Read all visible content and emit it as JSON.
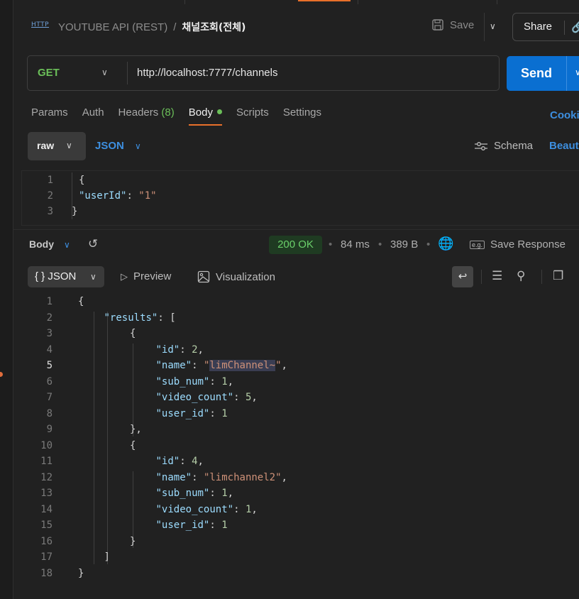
{
  "header": {
    "icon_text": "HTTP",
    "collection": "YOUTUBE API (REST)",
    "separator": "/",
    "request_name": "채널조회(전체)",
    "save_label": "Save",
    "share_label": "Share"
  },
  "request": {
    "method": "GET",
    "url": "http://localhost:7777/channels",
    "send_label": "Send"
  },
  "tabs": {
    "params": "Params",
    "auth": "Auth",
    "headers": "Headers",
    "headers_count": "(8)",
    "body": "Body",
    "scripts": "Scripts",
    "settings": "Settings",
    "cookies": "Cookies"
  },
  "body_options": {
    "mode": "raw",
    "format": "JSON",
    "schema_label": "Schema",
    "beautify_label": "Beautify"
  },
  "request_body": [
    {
      "n": "1",
      "text": "{"
    },
    {
      "n": "2",
      "key": "\"userId\"",
      "sep": ": ",
      "value": "\"1\""
    },
    {
      "n": "3",
      "text": "}"
    }
  ],
  "response": {
    "section_label": "Body",
    "status": "200 OK",
    "time": "84 ms",
    "size": "389 B",
    "save_response_label": "Save Response",
    "view_format": "{ } JSON",
    "preview_label": "Preview",
    "visualization_label": "Visualization"
  },
  "response_lines": [
    {
      "n": "1",
      "indent": 0,
      "parts": [
        [
          "punc",
          "{"
        ]
      ]
    },
    {
      "n": "2",
      "indent": 1,
      "parts": [
        [
          "key",
          "\"results\""
        ],
        [
          "punc",
          ": ["
        ]
      ]
    },
    {
      "n": "3",
      "indent": 2,
      "parts": [
        [
          "punc",
          "{"
        ]
      ]
    },
    {
      "n": "4",
      "indent": 3,
      "parts": [
        [
          "key",
          "\"id\""
        ],
        [
          "punc",
          ": "
        ],
        [
          "num",
          "2"
        ],
        [
          "punc",
          ","
        ]
      ]
    },
    {
      "n": "5",
      "indent": 3,
      "parts": [
        [
          "key",
          "\"name\""
        ],
        [
          "punc",
          ": "
        ],
        [
          "str",
          "\""
        ],
        [
          "str hl",
          "limChannel~"
        ],
        [
          "str",
          "\""
        ],
        [
          "punc",
          ","
        ]
      ]
    },
    {
      "n": "6",
      "indent": 3,
      "parts": [
        [
          "key",
          "\"sub_num\""
        ],
        [
          "punc",
          ": "
        ],
        [
          "num",
          "1"
        ],
        [
          "punc",
          ","
        ]
      ]
    },
    {
      "n": "7",
      "indent": 3,
      "parts": [
        [
          "key",
          "\"video_count\""
        ],
        [
          "punc",
          ": "
        ],
        [
          "num",
          "5"
        ],
        [
          "punc",
          ","
        ]
      ]
    },
    {
      "n": "8",
      "indent": 3,
      "parts": [
        [
          "key",
          "\"user_id\""
        ],
        [
          "punc",
          ": "
        ],
        [
          "num",
          "1"
        ]
      ]
    },
    {
      "n": "9",
      "indent": 2,
      "parts": [
        [
          "punc",
          "},"
        ]
      ]
    },
    {
      "n": "10",
      "indent": 2,
      "parts": [
        [
          "punc",
          "{"
        ]
      ]
    },
    {
      "n": "11",
      "indent": 3,
      "parts": [
        [
          "key",
          "\"id\""
        ],
        [
          "punc",
          ": "
        ],
        [
          "num",
          "4"
        ],
        [
          "punc",
          ","
        ]
      ]
    },
    {
      "n": "12",
      "indent": 3,
      "parts": [
        [
          "key",
          "\"name\""
        ],
        [
          "punc",
          ": "
        ],
        [
          "str",
          "\"limchannel2\""
        ],
        [
          "punc",
          ","
        ]
      ]
    },
    {
      "n": "13",
      "indent": 3,
      "parts": [
        [
          "key",
          "\"sub_num\""
        ],
        [
          "punc",
          ": "
        ],
        [
          "num",
          "1"
        ],
        [
          "punc",
          ","
        ]
      ]
    },
    {
      "n": "14",
      "indent": 3,
      "parts": [
        [
          "key",
          "\"video_count\""
        ],
        [
          "punc",
          ": "
        ],
        [
          "num",
          "1"
        ],
        [
          "punc",
          ","
        ]
      ]
    },
    {
      "n": "15",
      "indent": 3,
      "parts": [
        [
          "key",
          "\"user_id\""
        ],
        [
          "punc",
          ": "
        ],
        [
          "num",
          "1"
        ]
      ]
    },
    {
      "n": "16",
      "indent": 2,
      "parts": [
        [
          "punc",
          "}"
        ]
      ]
    },
    {
      "n": "17",
      "indent": 1,
      "parts": [
        [
          "punc",
          "]"
        ]
      ]
    },
    {
      "n": "18",
      "indent": 0,
      "parts": [
        [
          "punc",
          "}"
        ]
      ]
    }
  ],
  "active_line": "5",
  "colors": {
    "accent_orange": "#e8702a",
    "send_blue": "#0a6fd1",
    "link_blue": "#3d8fe0",
    "method_green": "#6bbf59",
    "status_green": "#6bd16b"
  }
}
